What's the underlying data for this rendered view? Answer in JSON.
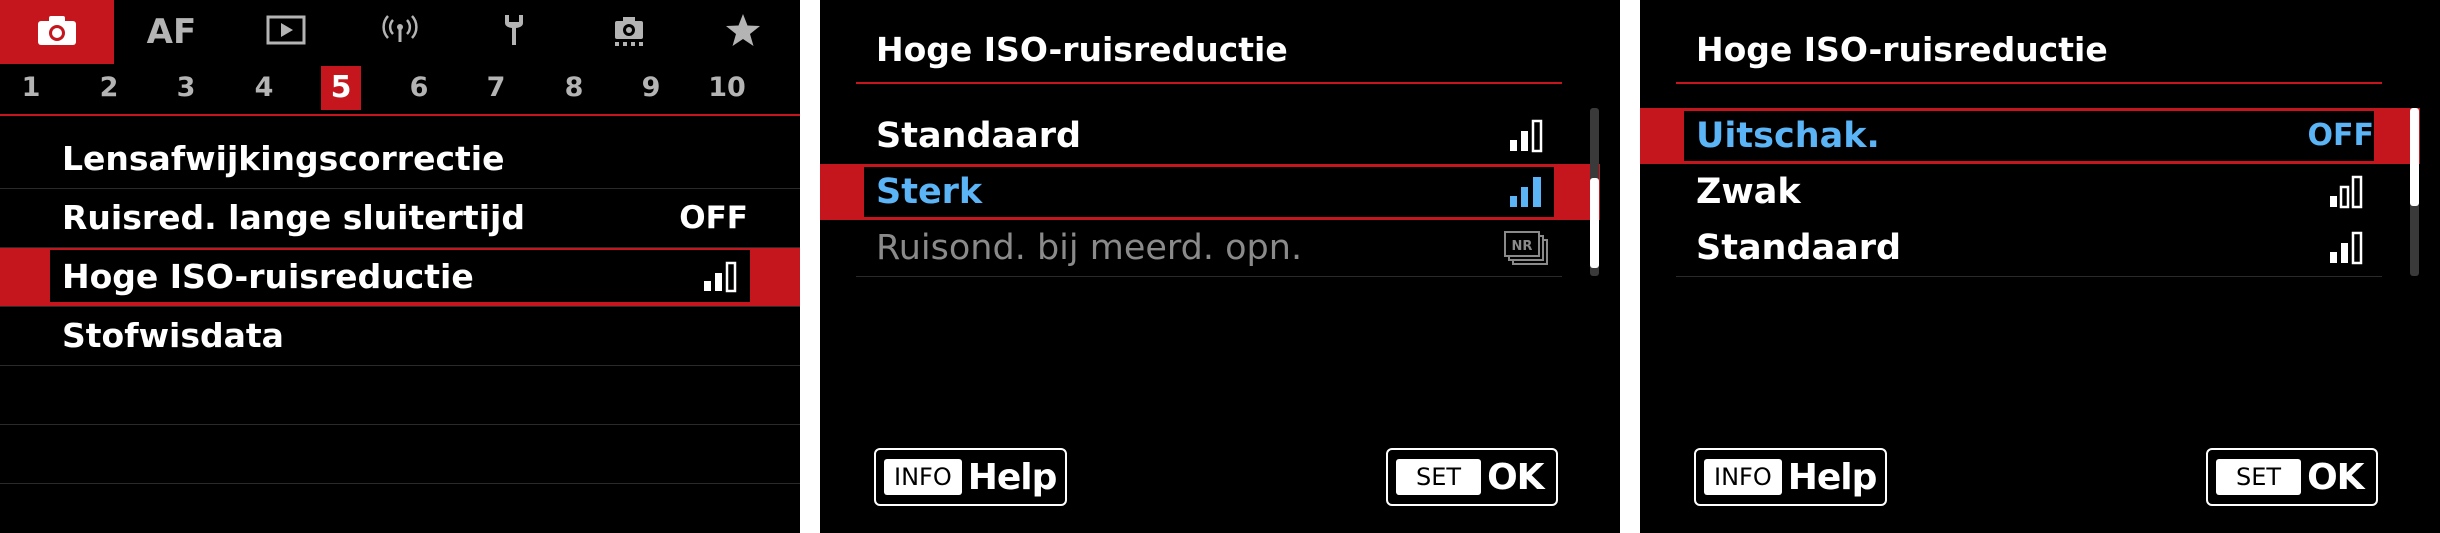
{
  "screen1": {
    "main_tabs": [
      {
        "icon": "camera-icon",
        "active": true
      },
      {
        "label": "AF"
      },
      {
        "icon": "play-icon"
      },
      {
        "icon": "wireless-icon"
      },
      {
        "icon": "wrench-icon"
      },
      {
        "icon": "custom-functions-icon"
      },
      {
        "icon": "star-icon"
      }
    ],
    "sub_tabs": [
      "1",
      "2",
      "3",
      "4",
      "5",
      "6",
      "7",
      "8",
      "9",
      "10"
    ],
    "active_sub_tab": "5",
    "items": [
      {
        "label": "Lensafwijkingscorrectie",
        "value": ""
      },
      {
        "label": "Ruisred. lange sluitertijd",
        "value": "OFF"
      },
      {
        "label": "Hoge ISO-ruisreductie",
        "value_icon": "signal-level-2-icon",
        "selected": true
      },
      {
        "label": "Stofwisdata",
        "value": ""
      }
    ]
  },
  "screen2": {
    "title": "Hoge ISO-ruisreductie",
    "items": [
      {
        "label": "Standaard",
        "value_icon": "signal-level-2-icon"
      },
      {
        "label": "Sterk",
        "value_icon": "signal-level-3-icon",
        "selected": true
      },
      {
        "label": "Ruisond. bij meerd. opn.",
        "value_icon": "nr-multi-shot-icon",
        "disabled": true
      }
    ],
    "nr_badge": "NR",
    "info_key": "INFO",
    "info_label": "Help",
    "set_key": "SET",
    "set_label": "OK"
  },
  "screen3": {
    "title": "Hoge ISO-ruisreductie",
    "items": [
      {
        "label": "Uitschak.",
        "value": "OFF",
        "selected": true
      },
      {
        "label": "Zwak",
        "value_icon": "signal-level-1-icon"
      },
      {
        "label": "Standaard",
        "value_icon": "signal-level-2-icon"
      }
    ],
    "info_key": "INFO",
    "info_label": "Help",
    "set_key": "SET",
    "set_label": "OK"
  },
  "colors": {
    "accent_red": "#c4161c",
    "selected_text_blue": "#5ab4f5",
    "background": "#000000"
  }
}
